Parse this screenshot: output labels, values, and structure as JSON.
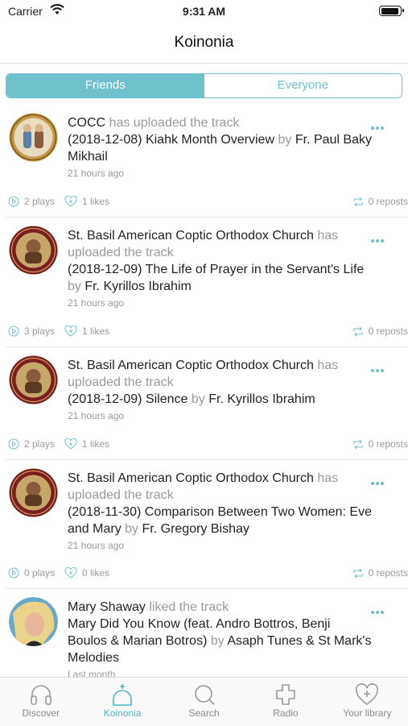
{
  "status": {
    "carrier": "Carrier",
    "time": "9:31 AM"
  },
  "navbar": {
    "title": "Koinonia"
  },
  "segments": {
    "friends": "Friends",
    "everyone": "Everyone",
    "selected": "Friends"
  },
  "feed": [
    {
      "user": "COCC",
      "action": "has uploaded the track",
      "track": "(2018-12-08) Kiahk Month Overview",
      "by": "by",
      "artist": "Fr. Paul Baky Mikhail",
      "time": "21 hours ago",
      "plays": "2 plays",
      "likes": "1 likes",
      "reposts": "0 reposts"
    },
    {
      "user": "St. Basil American Coptic Orthodox Church",
      "action": "has uploaded the track",
      "track": "(2018-12-09) The Life of Prayer in the Servant's Life",
      "by": "by",
      "artist": "Fr. Kyrillos Ibrahim",
      "time": "21 hours ago",
      "plays": "3 plays",
      "likes": "1 likes",
      "reposts": "0 reposts"
    },
    {
      "user": "St. Basil American Coptic Orthodox Church",
      "action": "has uploaded the track",
      "track": "(2018-12-09) Silence",
      "by": "by",
      "artist": "Fr. Kyrillos Ibrahim",
      "time": "21 hours ago",
      "plays": "2 plays",
      "likes": "1 likes",
      "reposts": "0 reposts"
    },
    {
      "user": "St. Basil American Coptic Orthodox Church",
      "action": "has uploaded the track",
      "track": "(2018-11-30) Comparison Between Two Women: Eve and Mary",
      "by": "by",
      "artist": "Fr. Gregory Bishay",
      "time": "21 hours ago",
      "plays": "0 plays",
      "likes": "0 likes",
      "reposts": "0 reposts"
    },
    {
      "user": "Mary Shaway",
      "action": "liked the track",
      "track": "Mary Did You Know (feat. Andro Bottros, Benji Boulos & Marian Botros)",
      "by": "by",
      "artist": "Asaph Tunes & St Mark's Melodies",
      "time": "Last month",
      "plays": "",
      "likes": "",
      "reposts": ""
    }
  ],
  "tabs": [
    "Discover",
    "Koinonia",
    "Search",
    "Radio",
    "Your library"
  ],
  "active_tab": "Koinonia",
  "colors": {
    "accent": "#6fc2cd",
    "tab_active": "#4cb7c6",
    "muted": "#9a9a9a"
  }
}
